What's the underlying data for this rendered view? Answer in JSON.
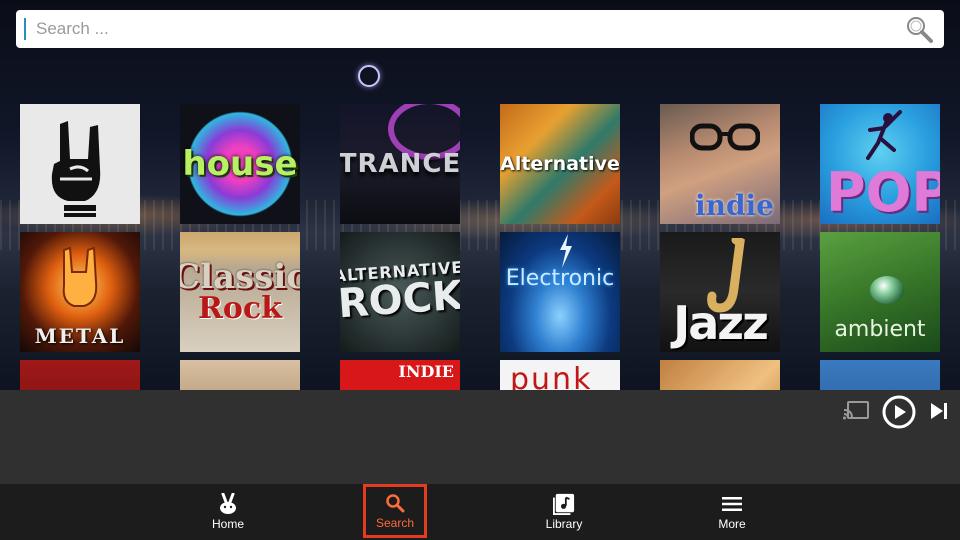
{
  "search": {
    "placeholder": "Search ...",
    "value": ""
  },
  "genres": [
    {
      "id": "metal-hand",
      "label": ""
    },
    {
      "id": "house",
      "label": "house"
    },
    {
      "id": "trance",
      "label": "TRANCE"
    },
    {
      "id": "alternative",
      "label": "Alternative"
    },
    {
      "id": "indie",
      "label": "indie"
    },
    {
      "id": "pop",
      "label": "POP"
    },
    {
      "id": "metal",
      "label": "METAL"
    },
    {
      "id": "classic-rock",
      "label_line1": "Classic",
      "label_line2": "Rock"
    },
    {
      "id": "alternative-rock",
      "label_line1": "ALTERNATIVE",
      "label_line2": "ROCK"
    },
    {
      "id": "electronic",
      "label": "Electronic"
    },
    {
      "id": "jazz",
      "label": "Jazz"
    },
    {
      "id": "ambient",
      "label": "ambient"
    },
    {
      "id": "row3-1",
      "label": ""
    },
    {
      "id": "row3-2",
      "label": ""
    },
    {
      "id": "indie-2",
      "label": "INDIE"
    },
    {
      "id": "punk",
      "label": "punk"
    },
    {
      "id": "row3-5",
      "label": ""
    },
    {
      "id": "row3-6",
      "label": ""
    }
  ],
  "player": {
    "cast_icon": "cast-icon",
    "play_icon": "play-circle-icon",
    "next_icon": "skip-next-icon"
  },
  "nav": {
    "items": [
      {
        "label": "Home",
        "icon": "rabbit-icon",
        "active": false
      },
      {
        "label": "Search",
        "icon": "search-icon",
        "active": true
      },
      {
        "label": "Library",
        "icon": "music-library-icon",
        "active": false
      },
      {
        "label": "More",
        "icon": "menu-icon",
        "active": false
      }
    ]
  },
  "colors": {
    "accent": "#e23b1e",
    "search_active_text": "#ff6a3a",
    "player_bg": "#303030",
    "nav_bg": "#1c1c1c"
  }
}
